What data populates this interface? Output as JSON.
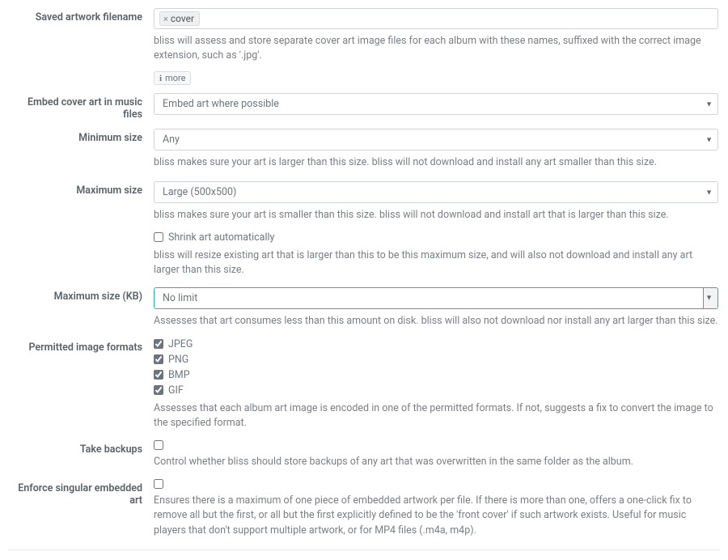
{
  "filename": {
    "label": "Saved artwork filename",
    "tag": "cover",
    "help": "bliss will assess and store separate cover art image files for each album with these names, suffixed with the correct image extension, such as '.jpg'.",
    "more": "more"
  },
  "embed": {
    "label": "Embed cover art in music files",
    "value": "Embed art where possible"
  },
  "minSize": {
    "label": "Minimum size",
    "value": "Any",
    "help": "bliss makes sure your art is larger than this size. bliss will not download and install any art smaller than this size."
  },
  "maxSize": {
    "label": "Maximum size",
    "value": "Large (500x500)",
    "help": "bliss makes sure your art is smaller than this size. bliss will not download and install art that is larger than this size.",
    "shrinkLabel": "Shrink art automatically",
    "shrinkHelp": "bliss will resize existing art that is larger than this to be this maximum size, and will also not download and install any art larger than this size."
  },
  "maxKB": {
    "label": "Maximum size (KB)",
    "value": "No limit",
    "help": "Assesses that art consumes less than this amount on disk. bliss will also not download nor install any art larger than this size."
  },
  "formats": {
    "label": "Permitted image formats",
    "items": [
      "JPEG",
      "PNG",
      "BMP",
      "GIF"
    ],
    "help": "Assesses that each album art image is encoded in one of the permitted formats. If not, suggests a fix to convert the image to the specified format."
  },
  "backups": {
    "label": "Take backups",
    "help": "Control whether bliss should store backups of any art that was overwritten in the same folder as the album."
  },
  "singular": {
    "label": "Enforce singular embedded art",
    "help": "Ensures there is a maximum of one piece of embedded artwork per file. If there is more than one, offers a one-click fix to remove all but the first, or all but the first explicitly defined to be the 'front cover' if such artwork exists. Useful for music players that don't support multiple artwork, or for MP4 files (.m4a, m4p)."
  }
}
